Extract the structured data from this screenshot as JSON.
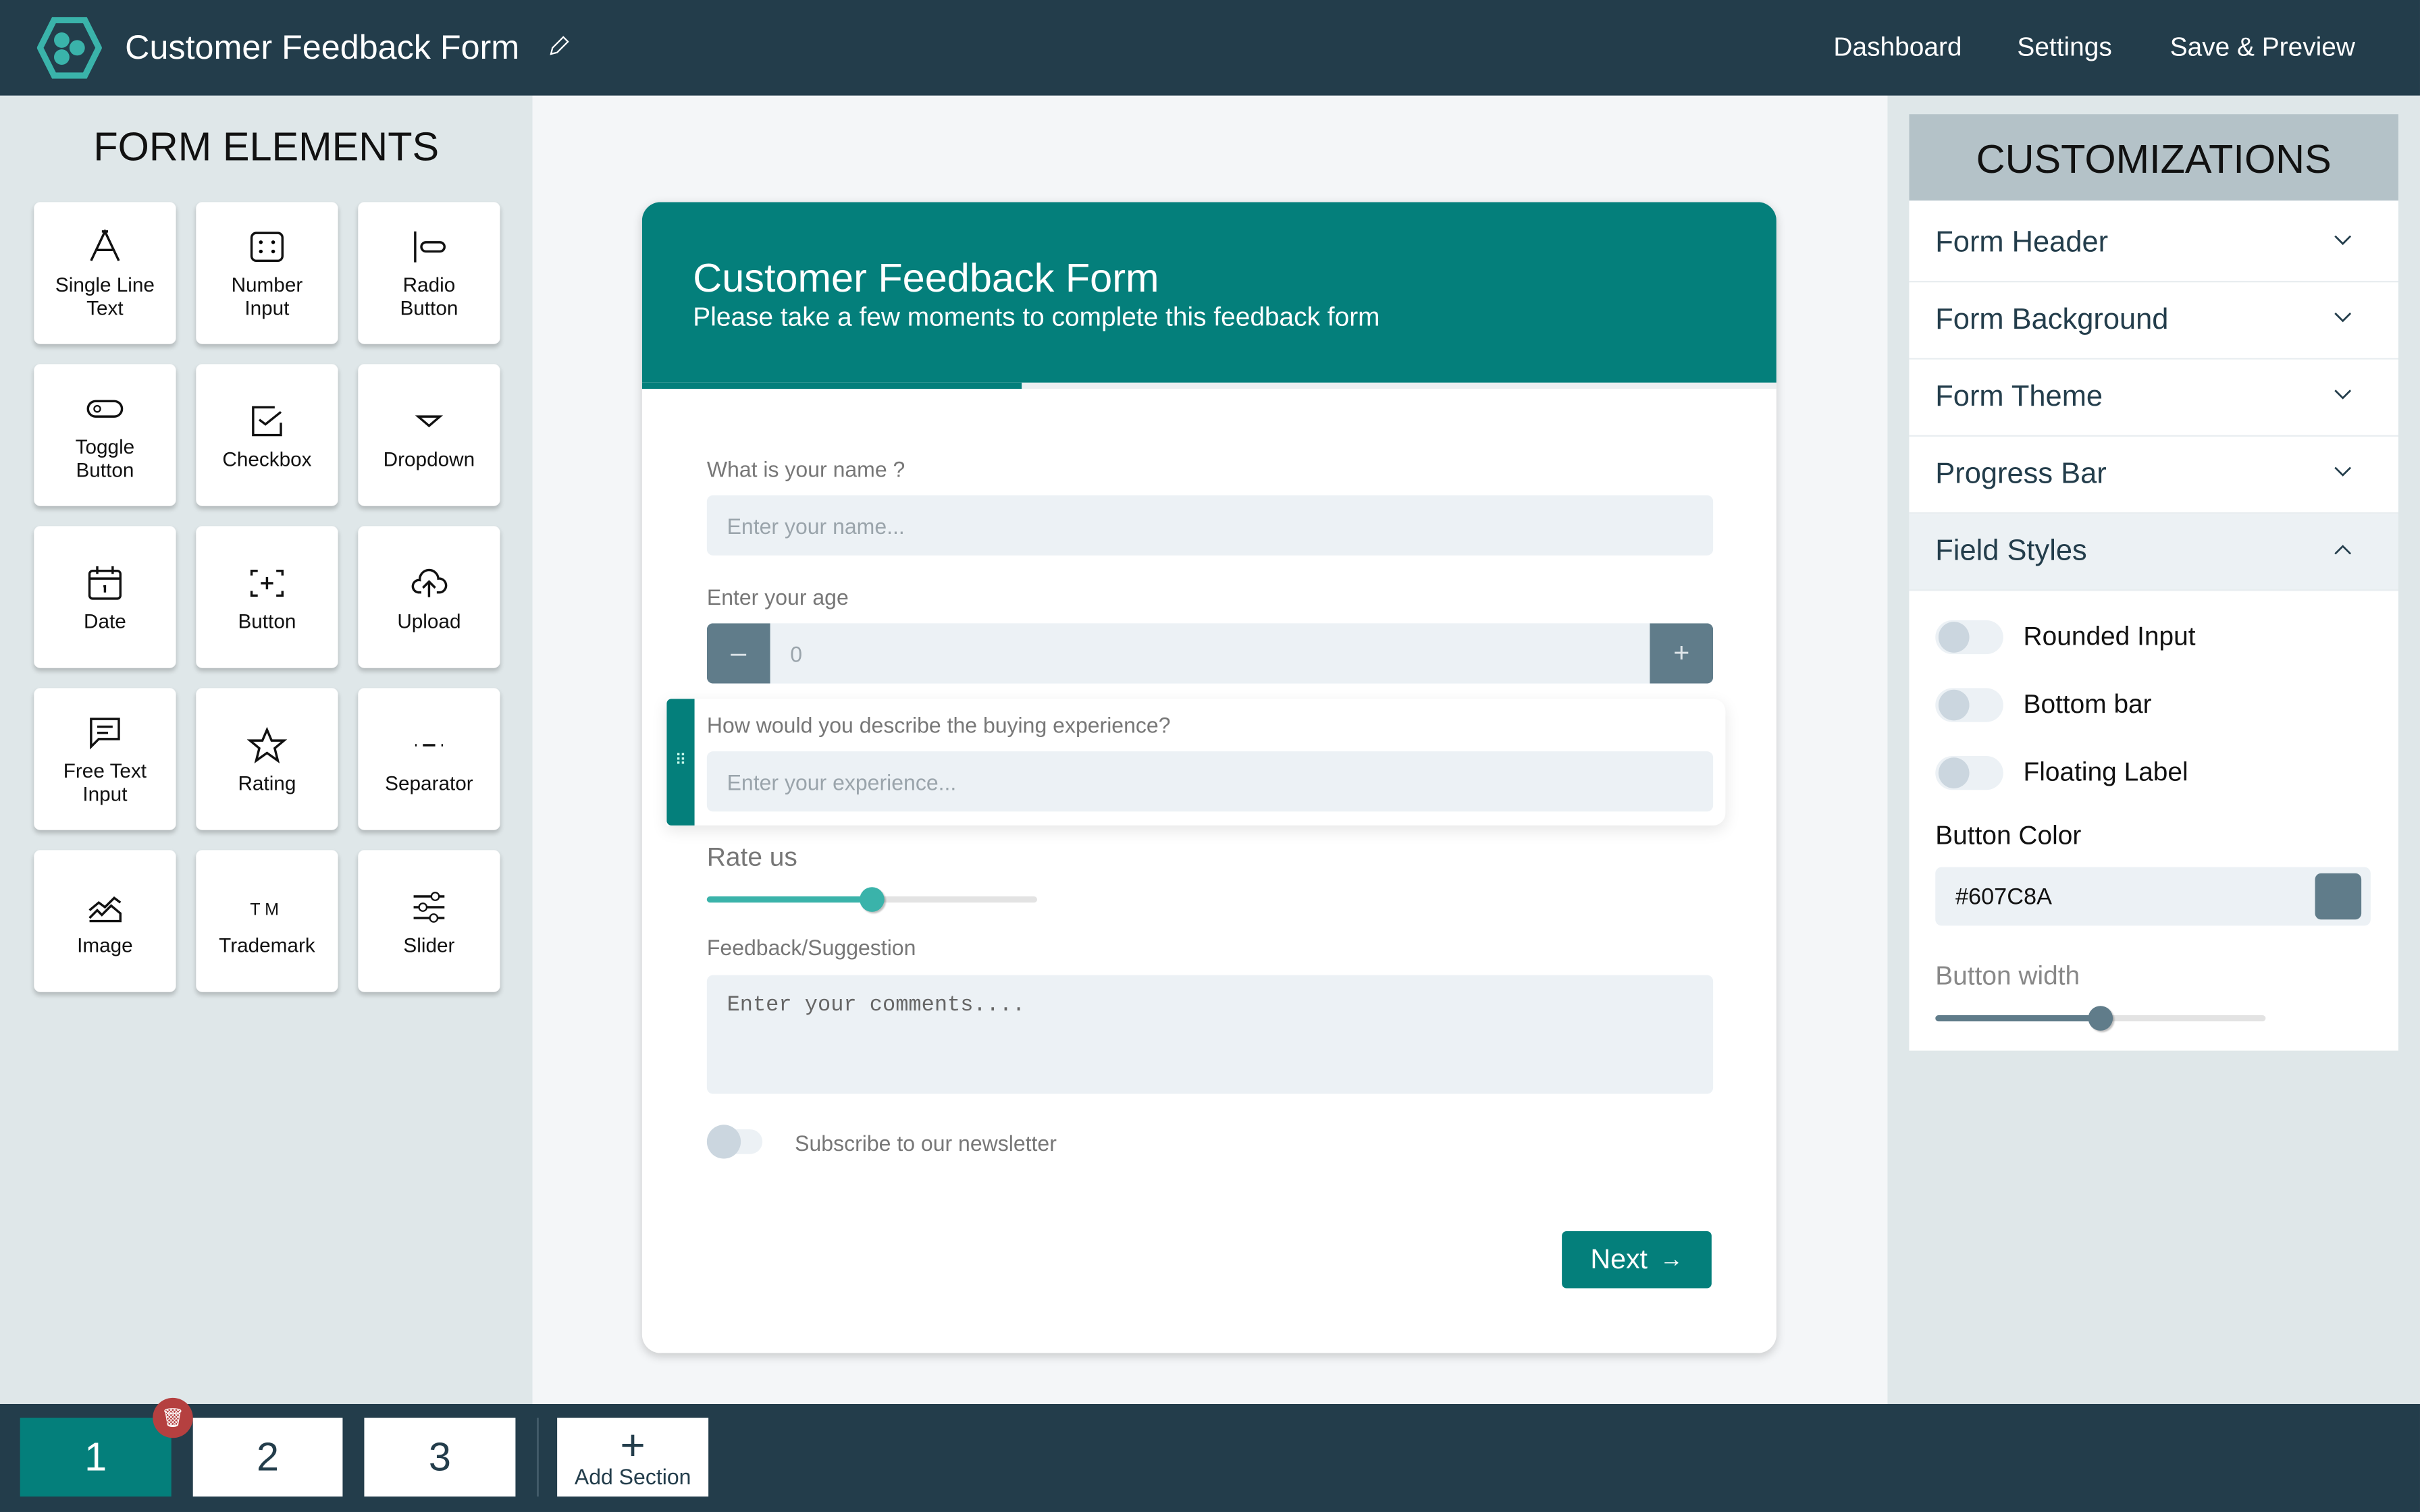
{
  "header": {
    "title": "Customer Feedback Form",
    "nav": [
      "Dashboard",
      "Settings",
      "Save & Preview"
    ]
  },
  "left_panel": {
    "title": "FORM ELEMENTS",
    "elements": [
      {
        "label": "Single Line Text",
        "icon": "font-icon"
      },
      {
        "label": "Number Input",
        "icon": "number-icon"
      },
      {
        "label": "Radio Button",
        "icon": "radio-icon"
      },
      {
        "label": "Toggle Button",
        "icon": "toggle-icon"
      },
      {
        "label": "Checkbox",
        "icon": "checkbox-icon"
      },
      {
        "label": "Dropdown",
        "icon": "dropdown-icon"
      },
      {
        "label": "Date",
        "icon": "calendar-icon"
      },
      {
        "label": "Button",
        "icon": "button-icon"
      },
      {
        "label": "Upload",
        "icon": "upload-icon"
      },
      {
        "label": "Free Text Input",
        "icon": "message-icon"
      },
      {
        "label": "Rating",
        "icon": "star-icon"
      },
      {
        "label": "Separator",
        "icon": "separator-icon"
      },
      {
        "label": "Image",
        "icon": "image-icon"
      },
      {
        "label": "Trademark",
        "icon": "trademark-icon"
      },
      {
        "label": "Slider",
        "icon": "slider-icon"
      }
    ]
  },
  "form": {
    "title": "Customer Feedback Form",
    "subtitle": "Please take a few moments to complete this feedback form",
    "progress": 0.335,
    "name_label": "What is your name ?",
    "name_placeholder": "Enter your name...",
    "age_label": "Enter your age",
    "age_value": "0",
    "minus": "–",
    "plus": "+",
    "experience_label": "How would you describe the buying experience?",
    "experience_placeholder": "Enter your experience...",
    "rate_label": "Rate us",
    "rate_value": 0.5,
    "feedback_label": "Feedback/Suggestion",
    "feedback_placeholder": "Enter your comments....",
    "newsletter_label": "Subscribe to our newsletter",
    "newsletter_on": false,
    "next_label": "Next"
  },
  "customizations": {
    "title": "CUSTOMIZATIONS",
    "sections": [
      "Form Header",
      "Form Background",
      "Form Theme",
      "Progress Bar",
      "Field Styles"
    ],
    "field_styles": {
      "toggles": [
        {
          "label": "Rounded Input",
          "on": false
        },
        {
          "label": "Bottom bar",
          "on": false
        },
        {
          "label": "Floating Label",
          "on": false
        }
      ],
      "button_color_label": "Button Color",
      "button_color": "#607C8A",
      "button_width_label": "Button width",
      "button_width": 0.5
    }
  },
  "sections": {
    "items": [
      "1",
      "2",
      "3"
    ],
    "active": "1",
    "add_label": "Add Section"
  },
  "colors": {
    "header": "#233d4b",
    "accent": "#047f7b",
    "button": "#607C8A",
    "delete": "#b54040"
  }
}
